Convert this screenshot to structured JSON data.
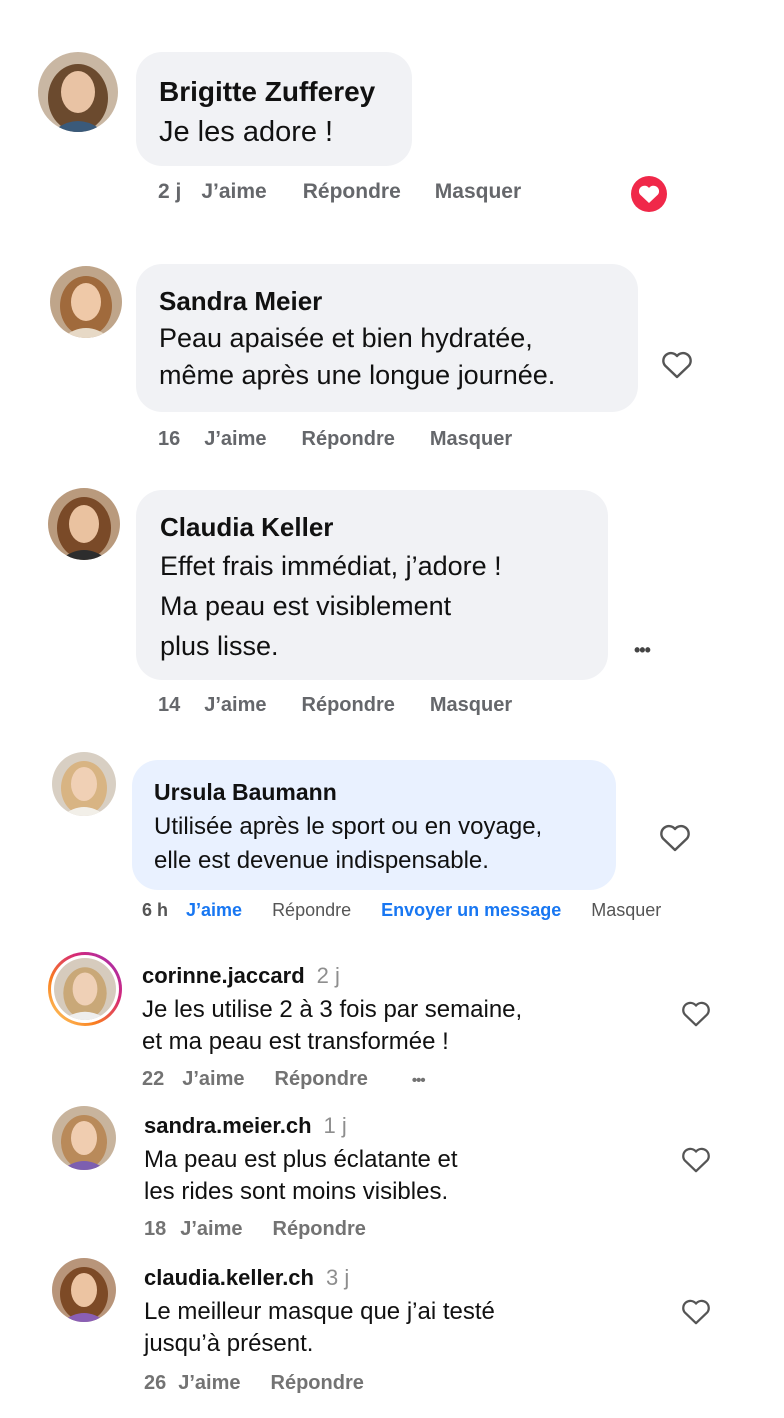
{
  "facebook_comments": [
    {
      "name": "Brigitte Zufferey",
      "text": "Je les adore !",
      "time": "2 j",
      "like": "J’aime",
      "reply": "Répondre",
      "hide": "Masquer",
      "reaction_icon": "heart-reaction-icon",
      "reaction_color": "#f02849"
    },
    {
      "name": "Sandra Meier",
      "text": "Peau apaisée et bien hydratée,\nmême après une longue journée.",
      "time": "16",
      "like": "J’aime",
      "reply": "Répondre",
      "hide": "Masquer",
      "icon": "heart-outline-icon"
    },
    {
      "name": "Claudia Keller",
      "text": "Effet frais immédiat, j’adore !\nMa peau est visiblement\nplus lisse.",
      "time": "14",
      "like": "J’aime",
      "reply": "Répondre",
      "hide": "Masquer",
      "more": "•••"
    },
    {
      "name": "Ursula Baumann",
      "text": "Utilisée après le sport ou en voyage,\nelle est devenue indispensable.",
      "time": "6 h",
      "like": "J’aime",
      "reply": "Répondre",
      "message": "Envoyer un message",
      "hide": "Masquer",
      "accent": "#1877f2",
      "icon": "heart-outline-icon"
    }
  ],
  "instagram_comments": [
    {
      "username": "corinne.jaccard",
      "time": "2 j",
      "text": "Je les utilise 2 à 3 fois par semaine,\net ma peau est transformée !",
      "likes": "22",
      "like": "J’aime",
      "reply": "Répondre",
      "more": "•••",
      "story_ring": true
    },
    {
      "username": "sandra.meier.ch",
      "time": "1 j",
      "text": "Ma peau est plus éclatante et\nles rides sont moins visibles.",
      "likes": "18",
      "like": "J’aime",
      "reply": "Répondre"
    },
    {
      "username": "claudia.keller.ch",
      "time": "3 j",
      "text": "Le meilleur masque que j’ai testé\njusqu’à présent.",
      "likes": "26",
      "like": "J’aime",
      "reply": "Répondre"
    }
  ]
}
